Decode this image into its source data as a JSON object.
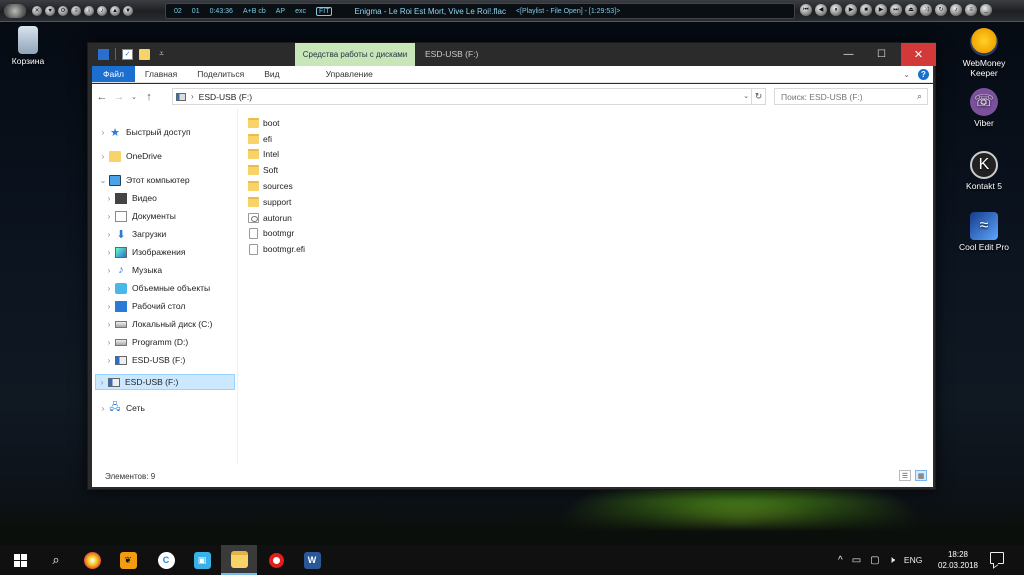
{
  "player": {
    "time_values": [
      "02",
      "01",
      "0:43:36"
    ],
    "mode_flags": [
      "A+B cb",
      "AP",
      "exc"
    ],
    "badge": "FIT",
    "track_title": "Enigma - Le Roi Est Mort, Vive Le Roi!.flac",
    "playlist_info": "<[Playlist - File Open] - [1:29:53]>"
  },
  "desktop_icons": [
    {
      "label": "Корзина",
      "icon": "recycle-bin-icon"
    },
    {
      "label": "WebMoney\nKeeper",
      "icon": "webmoney-icon"
    },
    {
      "label": "Viber",
      "icon": "viber-icon"
    },
    {
      "label": "Kontakt 5",
      "icon": "kontakt-icon"
    },
    {
      "label": "Cool Edit Pro",
      "icon": "cool-edit-icon"
    }
  ],
  "window": {
    "title": "ESD-USB (F:)",
    "context_tab": "Средства работы с дисками",
    "ribbon_tabs": {
      "file": "Файл",
      "home": "Главная",
      "share": "Поделиться",
      "view": "Вид",
      "manage": "Управление"
    },
    "address_path": "ESD-USB (F:)",
    "search_placeholder": "Поиск: ESD-USB (F:)"
  },
  "nav_tree": [
    {
      "label": "Быстрый доступ",
      "icon": "star-icon"
    },
    {
      "label": "OneDrive",
      "icon": "onedrive-folder-icon"
    },
    {
      "label": "Этот компьютер",
      "icon": "computer-icon"
    },
    {
      "label": "Видео",
      "icon": "video-icon"
    },
    {
      "label": "Документы",
      "icon": "documents-icon"
    },
    {
      "label": "Загрузки",
      "icon": "downloads-icon"
    },
    {
      "label": "Изображения",
      "icon": "pictures-icon"
    },
    {
      "label": "Музыка",
      "icon": "music-icon"
    },
    {
      "label": "Объемные объекты",
      "icon": "3d-objects-icon"
    },
    {
      "label": "Рабочий стол",
      "icon": "desktop-icon"
    },
    {
      "label": "Локальный диск (C:)",
      "icon": "local-disk-icon"
    },
    {
      "label": "Programm (D:)",
      "icon": "disk-icon"
    },
    {
      "label": "ESD-USB (F:)",
      "icon": "usb-drive-icon"
    },
    {
      "label": "ESD-USB (F:)",
      "icon": "usb-drive-icon"
    },
    {
      "label": "Сеть",
      "icon": "network-icon"
    }
  ],
  "files": [
    {
      "name": "boot",
      "type": "folder"
    },
    {
      "name": "efi",
      "type": "folder"
    },
    {
      "name": "Intel",
      "type": "folder"
    },
    {
      "name": "Soft",
      "type": "folder"
    },
    {
      "name": "sources",
      "type": "folder"
    },
    {
      "name": "support",
      "type": "folder"
    },
    {
      "name": "autorun",
      "type": "setup-info"
    },
    {
      "name": "bootmgr",
      "type": "file"
    },
    {
      "name": "bootmgr.efi",
      "type": "file"
    }
  ],
  "status": {
    "item_count": "Элементов: 9"
  },
  "taskbar": {
    "lang": "ENG",
    "time": "18:28",
    "date": "02.03.2018"
  },
  "colors": {
    "ribbon_file_tab": "#1a6fd0",
    "context_tab": "#c8e6b8",
    "close_button": "#d23a3a",
    "selection": "#cce8ff"
  }
}
